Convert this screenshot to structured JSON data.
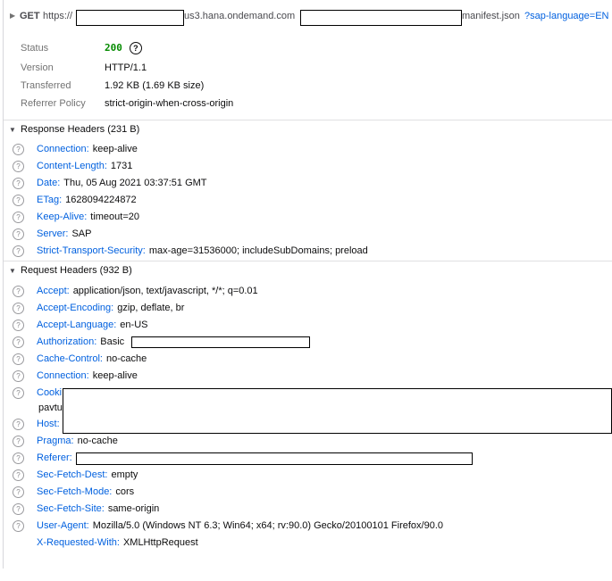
{
  "request": {
    "method": "GET",
    "url_scheme": "https://",
    "url_host_part": "us3.hana.ondemand.com",
    "url_path_part": "manifest.json",
    "url_query": "?sap-language=EN"
  },
  "summary": {
    "status_label": "Status",
    "status_value": "200",
    "version_label": "Version",
    "version_value": "HTTP/1.1",
    "transferred_label": "Transferred",
    "transferred_value": "1.92 KB (1.69 KB size)",
    "referrer_label": "Referrer Policy",
    "referrer_value": "strict-origin-when-cross-origin"
  },
  "response_headers": {
    "title": "Response Headers (231 B)",
    "items": [
      {
        "name": "Connection:",
        "value": "keep-alive"
      },
      {
        "name": "Content-Length:",
        "value": "1731"
      },
      {
        "name": "Date:",
        "value": "Thu, 05 Aug 2021 03:37:51 GMT"
      },
      {
        "name": "ETag:",
        "value": "1628094224872"
      },
      {
        "name": "Keep-Alive:",
        "value": "timeout=20"
      },
      {
        "name": "Server:",
        "value": "SAP"
      },
      {
        "name": "Strict-Transport-Security:",
        "value": "max-age=31536000; includeSubDomains; preload"
      }
    ]
  },
  "request_headers": {
    "title": "Request Headers (932 B)",
    "items": [
      {
        "name": "Accept:",
        "value": "application/json, text/javascript, */*; q=0.01"
      },
      {
        "name": "Accept-Encoding:",
        "value": "gzip, deflate, br"
      },
      {
        "name": "Accept-Language:",
        "value": "en-US"
      },
      {
        "name": "Authorization:",
        "value": "Basic"
      },
      {
        "name": "Cache-Control:",
        "value": "no-cache"
      },
      {
        "name": "Connection:",
        "value": "keep-alive"
      },
      {
        "name": "Cooki",
        "value": ""
      },
      {
        "name": "Host:",
        "value": ""
      },
      {
        "name": "Pragma:",
        "value": "no-cache"
      },
      {
        "name": "Referer:",
        "value": ""
      },
      {
        "name": "Sec-Fetch-Dest:",
        "value": "empty"
      },
      {
        "name": "Sec-Fetch-Mode:",
        "value": "cors"
      },
      {
        "name": "Sec-Fetch-Site:",
        "value": "same-origin"
      },
      {
        "name": "User-Agent:",
        "value": "Mozilla/5.0 (Windows NT 6.3; Win64; x64; rv:90.0) Gecko/20100101 Firefox/90.0"
      },
      {
        "name": "X-Requested-With:",
        "value": "XMLHttpRequest"
      }
    ],
    "cookie_fragment": "pavtu"
  }
}
